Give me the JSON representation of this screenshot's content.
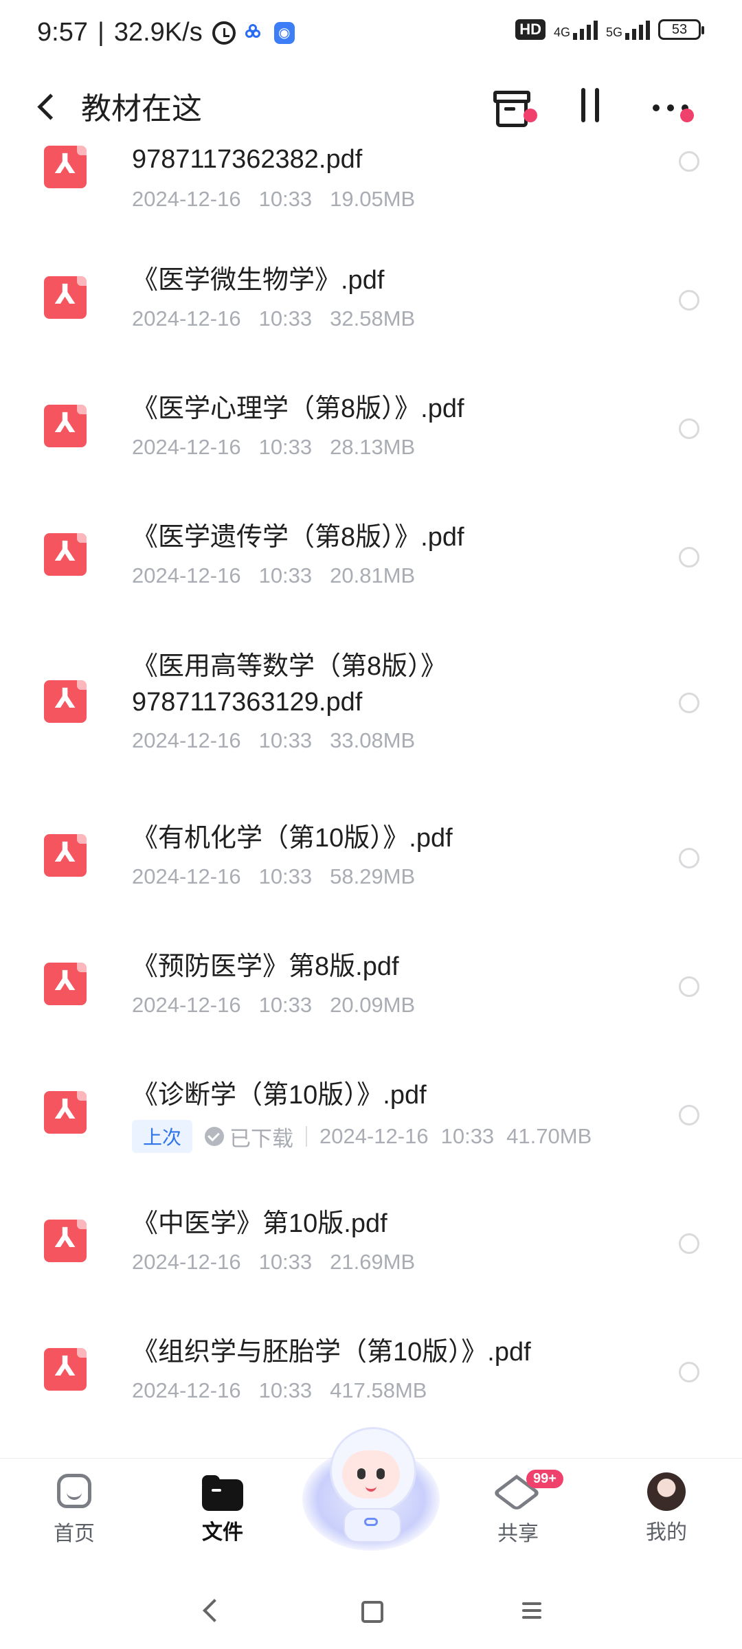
{
  "status_bar": {
    "time": "9:57",
    "net_speed": "32.9K/s",
    "hd_label": "HD",
    "net_a": "4G",
    "net_b": "5G",
    "battery": "53"
  },
  "header": {
    "title": "教材在这"
  },
  "files": [
    {
      "name": "9787117362382.pdf",
      "date": "2024-12-16",
      "time": "10:33",
      "size": "19.05MB"
    },
    {
      "name": "《医学微生物学》.pdf",
      "date": "2024-12-16",
      "time": "10:33",
      "size": "32.58MB"
    },
    {
      "name": "《医学心理学（第8版）》.pdf",
      "date": "2024-12-16",
      "time": "10:33",
      "size": "28.13MB"
    },
    {
      "name": "《医学遗传学（第8版）》.pdf",
      "date": "2024-12-16",
      "time": "10:33",
      "size": "20.81MB"
    },
    {
      "name": "《医用高等数学（第8版）》 9787117363129.pdf",
      "date": "2024-12-16",
      "time": "10:33",
      "size": "33.08MB"
    },
    {
      "name": "《有机化学（第10版）》.pdf",
      "date": "2024-12-16",
      "time": "10:33",
      "size": "58.29MB"
    },
    {
      "name": "《预防医学》第8版.pdf",
      "date": "2024-12-16",
      "time": "10:33",
      "size": "20.09MB"
    },
    {
      "name": "《诊断学（第10版）》.pdf",
      "date": "2024-12-16",
      "time": "10:33",
      "size": "41.70MB",
      "tag": "上次",
      "status": "已下载"
    },
    {
      "name": "《中医学》第10版.pdf",
      "date": "2024-12-16",
      "time": "10:33",
      "size": "21.69MB"
    },
    {
      "name": "《组织学与胚胎学（第10版）》.pdf",
      "date": "2024-12-16",
      "time": "10:33",
      "size": "417.58MB"
    }
  ],
  "tabs": [
    {
      "label": "首页",
      "icon": "home-icon"
    },
    {
      "label": "文件",
      "icon": "folder-icon",
      "active": true
    },
    {
      "label": "",
      "icon": "mascot-icon"
    },
    {
      "label": "共享",
      "icon": "share-icon",
      "badge": "99+"
    },
    {
      "label": "我的",
      "icon": "avatar"
    }
  ],
  "colors": {
    "pdf_icon": "#f4555e",
    "accent_red": "#f0416c",
    "meta_text": "#a9adb3",
    "tag_blue": "#2f74e8"
  }
}
